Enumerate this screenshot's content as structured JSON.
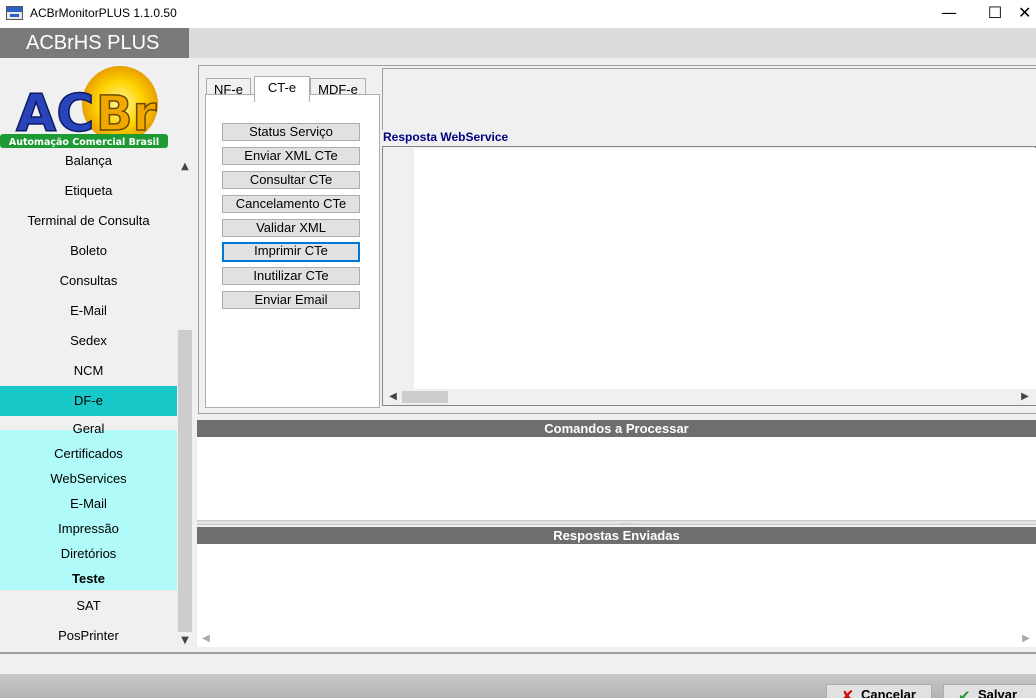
{
  "window": {
    "title": "ACBrMonitorPLUS 1.1.0.50",
    "minimize": "—",
    "maximize": "☐",
    "close": "✕"
  },
  "header": {
    "brand": "ACBrHS PLUS"
  },
  "logo": {
    "text_ac": "AC",
    "text_br": "Br",
    "tagline": "Automação Comercial Brasil"
  },
  "sidebar": {
    "items": [
      {
        "label": "Balança"
      },
      {
        "label": "Etiqueta"
      },
      {
        "label": "Terminal de Consulta"
      },
      {
        "label": "Boleto"
      },
      {
        "label": "Consultas"
      },
      {
        "label": "E-Mail"
      },
      {
        "label": "Sedex"
      },
      {
        "label": "NCM"
      },
      {
        "label": "DF-e",
        "selected": true
      },
      {
        "label": "Geral"
      },
      {
        "label": "Certificados"
      },
      {
        "label": "WebServices"
      },
      {
        "label": "E-Mail"
      },
      {
        "label": "Impressão"
      },
      {
        "label": "Diretórios"
      },
      {
        "label": "Teste",
        "bold": true
      },
      {
        "label": "SAT"
      },
      {
        "label": "PosPrinter"
      }
    ],
    "selected_color": "#19c8c8",
    "submenu_color": "#b0fafa"
  },
  "tabs": [
    {
      "label": "NF-e"
    },
    {
      "label": "CT-e",
      "active": true
    },
    {
      "label": "MDF-e"
    }
  ],
  "buttons": [
    {
      "label": "Status Serviço"
    },
    {
      "label": "Enviar XML CTe"
    },
    {
      "label": "Consultar CTe"
    },
    {
      "label": "Cancelamento CTe"
    },
    {
      "label": "Validar XML"
    },
    {
      "label": "Imprimir CTe",
      "focused": true
    },
    {
      "label": "Inutilizar CTe"
    },
    {
      "label": "Enviar Email"
    }
  ],
  "webservice": {
    "label": "Resposta WebService"
  },
  "sections": {
    "commands": "Comandos a Processar",
    "responses": "Respostas Enviadas"
  },
  "footer": {
    "cancel_label": "Cancelar",
    "save_label": "Salvar",
    "cancel_icon": "cross-icon",
    "save_icon": "checkmark-icon"
  }
}
